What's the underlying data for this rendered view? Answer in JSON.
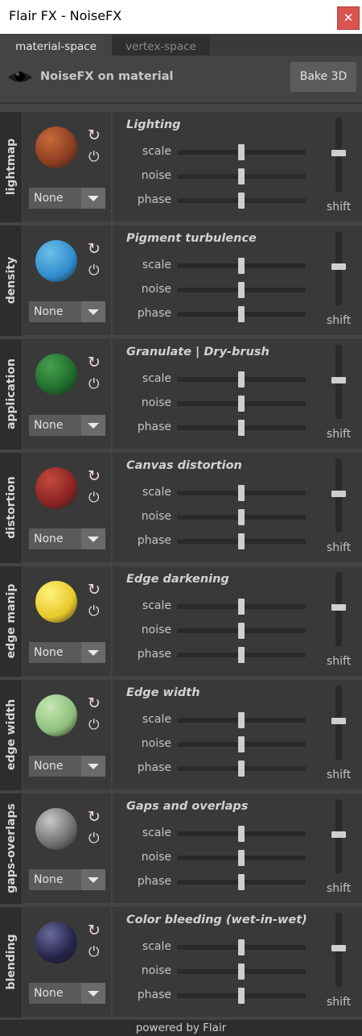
{
  "window": {
    "title": "Flair FX - NoiseFX",
    "close_icon": "close-icon"
  },
  "tabs": [
    {
      "label": "material-space",
      "active": true
    },
    {
      "label": "vertex-space",
      "active": false
    }
  ],
  "header": {
    "eye_icon": "eye-icon",
    "label": "NoiseFX on material",
    "bake_label": "Bake 3D"
  },
  "footer": {
    "text": "powered by Flair"
  },
  "colors": {
    "close_button": "#d9534f",
    "background": "#444444",
    "panel": "#393939",
    "side_strip": "#2d2d2d",
    "slider_handle": "#cfcfcf"
  },
  "panels": [
    {
      "side_label": "lightmap",
      "title": "Lighting",
      "select_value": "None",
      "sphere_color": "#8a3d20",
      "sphere_highlight": "#c86a3a",
      "row_labels": [
        "scale",
        "noise",
        "phase"
      ],
      "sliders": [
        0.5,
        0.5,
        0.5
      ],
      "shift_label": "shift",
      "shift_value": 0.5
    },
    {
      "side_label": "density",
      "title": "Pigment turbulence",
      "select_value": "None",
      "sphere_color": "#2f8ccc",
      "sphere_highlight": "#6bbfe8",
      "row_labels": [
        "scale",
        "noise",
        "phase"
      ],
      "sliders": [
        0.5,
        0.5,
        0.5
      ],
      "shift_label": "shift",
      "shift_value": 0.5
    },
    {
      "side_label": "application",
      "title": "Granulate | Dry-brush",
      "select_value": "None",
      "sphere_color": "#1e6b2a",
      "sphere_highlight": "#48a04e",
      "row_labels": [
        "scale",
        "noise",
        "phase"
      ],
      "sliders": [
        0.5,
        0.5,
        0.5
      ],
      "shift_label": "shift",
      "shift_value": 0.5
    },
    {
      "side_label": "distortion",
      "title": "Canvas distortion",
      "select_value": "None",
      "sphere_color": "#8a2320",
      "sphere_highlight": "#c04a40",
      "row_labels": [
        "scale",
        "noise",
        "phase"
      ],
      "sliders": [
        0.5,
        0.5,
        0.5
      ],
      "shift_label": "shift",
      "shift_value": 0.5
    },
    {
      "side_label": "edge manip",
      "title": "Edge darkening",
      "select_value": "None",
      "sphere_color": "#e6c82a",
      "sphere_highlight": "#fff27a",
      "row_labels": [
        "scale",
        "noise",
        "phase"
      ],
      "sliders": [
        0.5,
        0.5,
        0.5
      ],
      "shift_label": "shift",
      "shift_value": 0.5
    },
    {
      "side_label": "edge width",
      "title": "Edge width",
      "select_value": "None",
      "sphere_color": "#8ec07a",
      "sphere_highlight": "#c6e6b6",
      "row_labels": [
        "scale",
        "noise",
        "phase"
      ],
      "sliders": [
        0.5,
        0.5,
        0.5
      ],
      "shift_label": "shift",
      "shift_value": 0.5
    },
    {
      "side_label": "gaps-overlaps",
      "title": "Gaps and overlaps",
      "select_value": "None",
      "sphere_color": "#6e6e6e",
      "sphere_highlight": "#c8c8c8",
      "row_labels": [
        "scale",
        "noise",
        "phase"
      ],
      "sliders": [
        0.5,
        0.5,
        0.5
      ],
      "shift_label": "shift",
      "shift_value": 0.5
    },
    {
      "side_label": "blending",
      "title": "Color bleeding (wet-in-wet)",
      "select_value": "None",
      "sphere_color": "#24224a",
      "sphere_highlight": "#6a6a9a",
      "row_labels": [
        "scale",
        "noise",
        "phase"
      ],
      "sliders": [
        0.5,
        0.5,
        0.5
      ],
      "shift_label": "shift",
      "shift_value": 0.5
    }
  ]
}
